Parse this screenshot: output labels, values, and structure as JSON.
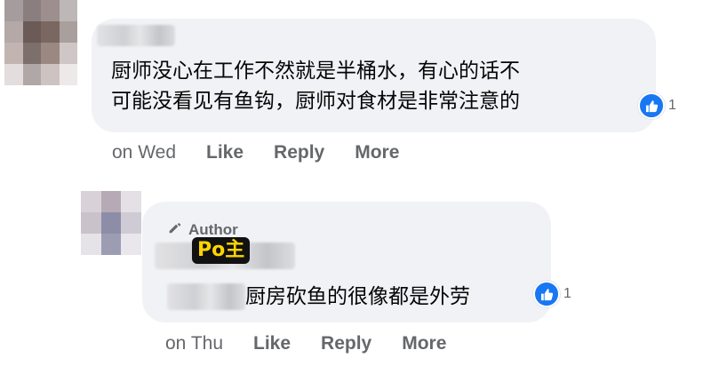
{
  "comments": [
    {
      "text_lines": [
        "厨师没心在工作不然就是半桶水，有心的话不",
        "可能没看见有鱼钩，厨师对食材是非常注意的"
      ],
      "reaction_count": "1",
      "time": "on Wed",
      "actions": [
        "Like",
        "Reply",
        "More"
      ]
    }
  ],
  "reply": {
    "author_badge": "Author",
    "po_tag": "Po主",
    "text": "厨房砍鱼的很像都是外劳",
    "reaction_count": "1",
    "time": "on Thu",
    "actions": [
      "Like",
      "Reply",
      "More"
    ]
  },
  "icons": {
    "like": "thumbs-up-icon",
    "author": "pencil-icon"
  },
  "colors": {
    "bubble": "#f0f2f5",
    "like_blue": "#1877f2",
    "secondary_text": "#65676b",
    "po_tag_bg": "#111111",
    "po_tag_text": "#ffd600"
  }
}
